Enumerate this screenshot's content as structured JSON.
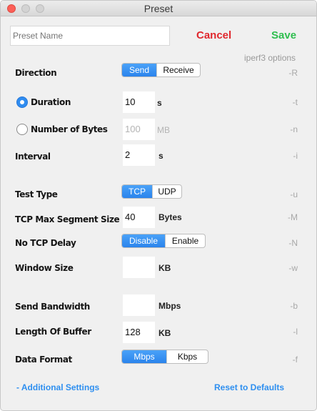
{
  "window": {
    "title": "Preset"
  },
  "header": {
    "preset_name_placeholder": "Preset Name",
    "cancel_label": "Cancel",
    "save_label": "Save",
    "options_caption": "iperf3 options"
  },
  "direction": {
    "label": "Direction",
    "options": [
      "Send",
      "Receive"
    ],
    "selected": "Send",
    "flag": "-R"
  },
  "duration": {
    "label": "Duration",
    "value": "10",
    "unit": "s",
    "flag": "-t",
    "selected": true
  },
  "bytes": {
    "label": "Number of Bytes",
    "placeholder": "100",
    "unit": "MB",
    "flag": "-n",
    "selected": false
  },
  "interval": {
    "label": "Interval",
    "value": "2",
    "unit": "s",
    "flag": "-i"
  },
  "test_type": {
    "label": "Test Type",
    "options": [
      "TCP",
      "UDP"
    ],
    "selected": "TCP",
    "flag": "-u"
  },
  "mss": {
    "label": "TCP Max Segment Size",
    "value": "40",
    "unit": "Bytes",
    "flag": "-M"
  },
  "no_delay": {
    "label": "No TCP Delay",
    "options": [
      "Disable",
      "Enable"
    ],
    "selected": "Disable",
    "flag": "-N"
  },
  "window_size": {
    "label": "Window Size",
    "value": "",
    "unit": "KB",
    "flag": "-w"
  },
  "bandwidth": {
    "label": "Send Bandwidth",
    "value": "",
    "unit": "Mbps",
    "flag": "-b"
  },
  "buffer": {
    "label": "Length Of Buffer",
    "value": "128",
    "unit": "KB",
    "flag": "-l"
  },
  "data_format": {
    "label": "Data Format",
    "options": [
      "Mbps",
      "Kbps"
    ],
    "selected": "Mbps",
    "flag": "-f"
  },
  "footer": {
    "additional_label": "- Additional Settings",
    "reset_label": "Reset to Defaults"
  },
  "colors": {
    "cancel": "#e0282e",
    "save": "#2fbe4f",
    "accent": "#2e8ff0",
    "flag": "#a8a8a8"
  }
}
